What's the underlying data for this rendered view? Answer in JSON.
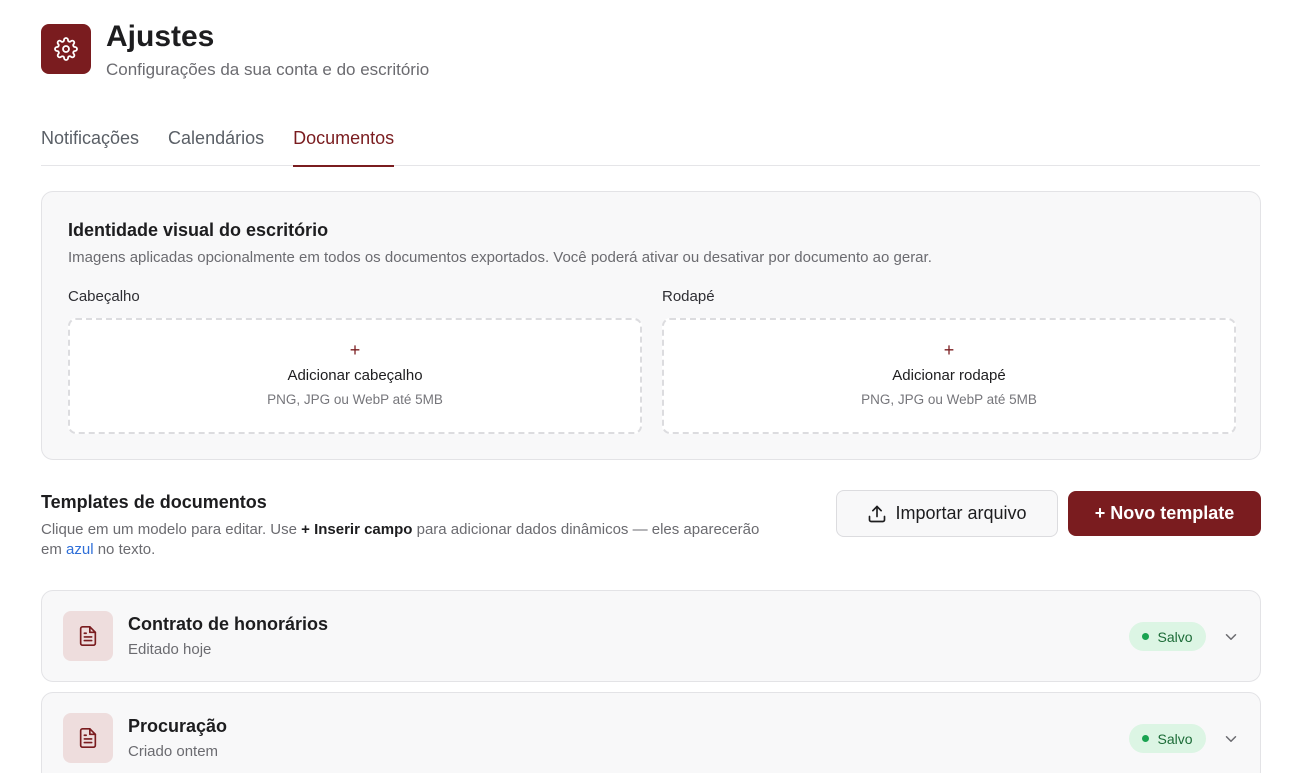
{
  "header": {
    "title": "Ajustes",
    "subtitle": "Configurações da sua conta e do escritório",
    "icon": "gear-icon"
  },
  "tabs": [
    {
      "label": "Notificações",
      "active": false
    },
    {
      "label": "Calendários",
      "active": false
    },
    {
      "label": "Documentos",
      "active": true
    }
  ],
  "identity": {
    "title": "Identidade visual do escritório",
    "description": "Imagens aplicadas opcionalmente em todos os documentos exportados. Você poderá ativar ou desativar por documento ao gerar.",
    "header_upload": {
      "label": "Cabeçalho",
      "plus": "+",
      "action": "Adicionar cabeçalho",
      "hint": "PNG, JPG ou WebP até 5MB"
    },
    "footer_upload": {
      "label": "Rodapé",
      "plus": "+",
      "action": "Adicionar rodapé",
      "hint": "PNG, JPG ou WebP até 5MB"
    }
  },
  "templates": {
    "title": "Templates de documentos",
    "desc_part1": "Clique em um modelo para editar. Use ",
    "desc_bold": "+ Inserir campo",
    "desc_part2": " para adicionar dados dinâmicos — eles aparecerão em ",
    "desc_blue": "azul",
    "desc_part3": " no texto.",
    "import_label": "Importar arquivo",
    "new_label": "+ Novo template",
    "items": [
      {
        "title": "Contrato de honorários",
        "subtitle": "Editado hoje",
        "status": "Salvo"
      },
      {
        "title": "Procuração",
        "subtitle": "Criado ontem",
        "status": "Salvo"
      }
    ]
  },
  "colors": {
    "brand": "#7a1c1f",
    "status_green": "#1aa351",
    "link_blue": "#2f6fd8"
  }
}
